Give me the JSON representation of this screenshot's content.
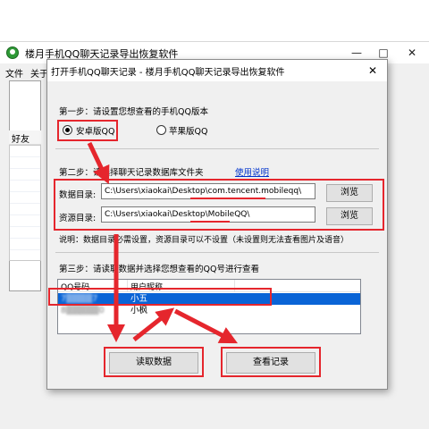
{
  "main_window": {
    "title": "楼月手机QQ聊天记录导出恢复软件",
    "menu": [
      "文件",
      "关于"
    ],
    "left_header": "好友"
  },
  "dialog": {
    "title": "打开手机QQ聊天记录 - 楼月手机QQ聊天记录导出恢复软件",
    "step1": {
      "label": "第一步：请设置您想查看的手机QQ版本",
      "android_label": "安卓版QQ",
      "apple_label": "苹果版QQ",
      "selected": "android"
    },
    "step2": {
      "label": "第二步：请选择聊天记录数据库文件夹",
      "help_link": "使用说明",
      "data_dir_label": "数据目录:",
      "data_dir_value": "C:\\Users\\xiaokai\\Desktop\\com.tencent.mobileqq\\",
      "res_dir_label": "资源目录:",
      "res_dir_value": "C:\\Users\\xiaokai\\Desktop\\MobileQQ\\",
      "browse_label": "浏览",
      "note": "说明：数据目录必需设置，资源目录可以不设置（未设置则无法查看图片及语音）"
    },
    "step3": {
      "label": "第三步：请读取数据并选择您想查看的QQ号进行查看",
      "columns": [
        "QQ号码",
        "用户昵称"
      ],
      "rows": [
        {
          "qq": "7▒▒▒▒7",
          "nickname": "小五",
          "selected": true
        },
        {
          "qq": "8▒▒▒▒▒0",
          "nickname": "小枫",
          "selected": false
        }
      ]
    },
    "buttons": {
      "read": "读取数据",
      "view": "查看记录"
    }
  },
  "colors": {
    "annotation_red": "#e5262d",
    "selection_blue": "#0a64d6",
    "link_blue": "#0033cc"
  }
}
